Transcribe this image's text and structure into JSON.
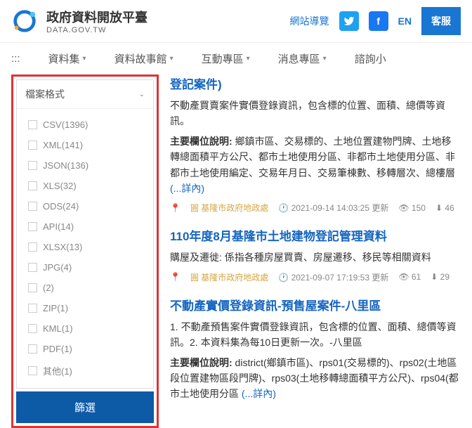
{
  "header": {
    "title": "政府資料開放平臺",
    "subtitle": "DATA.GOV.TW",
    "sitemap": "網站導覽",
    "lang": "EN",
    "cs": "客服"
  },
  "nav": {
    "menu_icon": ":::",
    "items": [
      "資料集",
      "資料故事館",
      "互動專區",
      "消息專區",
      "諮詢小"
    ]
  },
  "filter": {
    "title": "檔案格式",
    "items": [
      {
        "label": "CSV",
        "count": "(1396)"
      },
      {
        "label": "XML",
        "count": "(141)"
      },
      {
        "label": "JSON",
        "count": "(136)"
      },
      {
        "label": "XLS",
        "count": "(32)"
      },
      {
        "label": "ODS",
        "count": "(24)"
      },
      {
        "label": "API",
        "count": "(14)"
      },
      {
        "label": "XLSX",
        "count": "(13)"
      },
      {
        "label": "JPG",
        "count": "(4)"
      },
      {
        "label": "",
        "count": "(2)"
      },
      {
        "label": "ZIP",
        "count": "(1)"
      },
      {
        "label": "KML",
        "count": "(1)"
      },
      {
        "label": "PDF",
        "count": "(1)"
      },
      {
        "label": "其他",
        "count": "(1)"
      }
    ],
    "button": "篩選"
  },
  "results": [
    {
      "title": "登記案件)",
      "desc": "不動產買賣案件實價登錄資訊，包含標的位置、面積、總價等資訊。",
      "fields_label": "主要欄位說明:",
      "fields": " 鄉鎮市區、交易標的、土地位置建物門牌、土地移轉總面積平方公尺、都市土地使用分區、非都市土地使用分區、非都市土地使用編定、交易年月日、交易筆棟數、移轉層次、總樓層 ",
      "more": "(...詳內)",
      "org": "基隆市政府地政處",
      "time": "2021-09-14 14:03:25 更新",
      "views": "150",
      "downloads": "46"
    },
    {
      "title": "110年度8月基隆市土地建物登記管理資料",
      "desc": "購屋及遷徙: 係指各種房屋買賣、房屋遷移、移民等相關資料",
      "org": "基隆市政府地政處",
      "time": "2021-09-07 17:19:53 更新",
      "views": "61",
      "downloads": "29"
    },
    {
      "title": "不動產實價登錄資訊-預售屋案件-八里區",
      "desc": "1. 不動產預售案件實價登錄資訊，包含標的位置、面積、總價等資訊。2. 本資料集為每10日更新一次。-八里區",
      "fields_label": "主要欄位說明:",
      "fields": " district(鄉鎮市區)、rps01(交易標的)、rps02(土地區段位置建物區段門牌)、rps03(土地移轉總面積平方公尺)、rps04(都市土地使用分區 ",
      "more": "(...詳內)"
    }
  ]
}
